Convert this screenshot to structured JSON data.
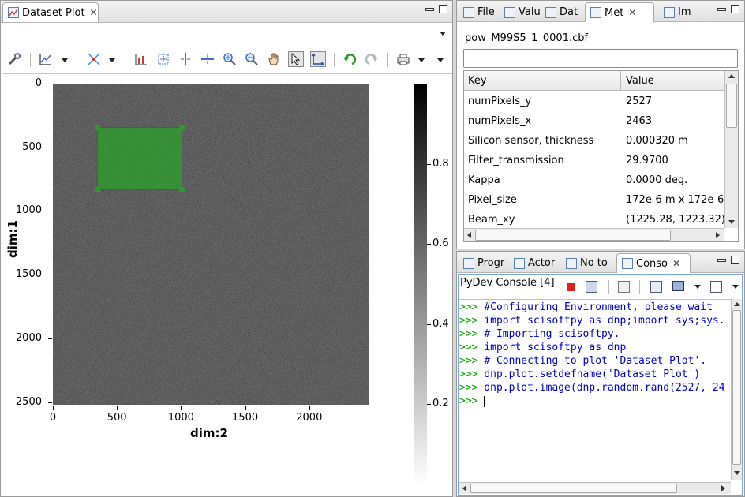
{
  "plot_view": {
    "tab_label": "Dataset Plot",
    "y_axis_label": "dim:1",
    "x_axis_label": "dim:2",
    "y_ticks": [
      "0",
      "500",
      "1000",
      "1500",
      "2000",
      "2500"
    ],
    "x_ticks": [
      "0",
      "500",
      "1000",
      "1500",
      "2000"
    ],
    "colorbar_ticks": [
      "0.8",
      "0.6",
      "0.4",
      "0.2"
    ],
    "roi_color": "#2e9a2e",
    "toolbar_icons": [
      "tools-icon",
      "chart-type-icon",
      "axes-icon",
      "histogram-icon",
      "zoom-box-icon",
      "vertical-profile-icon",
      "horizontal-profile-icon",
      "zoom-in-icon",
      "zoom-out-icon",
      "pan-hand-icon",
      "pointer-icon",
      "axes-select-icon",
      "undo-icon",
      "redo-icon",
      "print-icon"
    ]
  },
  "metadata_view": {
    "tabs": [
      "File",
      "Valu",
      "Dat",
      "Met",
      "Im"
    ],
    "active_tab": "Met",
    "filename": "pow_M99S5_1_0001.cbf",
    "filter_value": "",
    "columns": [
      "Key",
      "Value"
    ],
    "rows": [
      {
        "key": "numPixels_y",
        "value": "2527"
      },
      {
        "key": "numPixels_x",
        "value": "2463"
      },
      {
        "key": "Silicon sensor, thickness",
        "value": "0.000320 m"
      },
      {
        "key": "Filter_transmission",
        "value": "29.9700"
      },
      {
        "key": "Kappa",
        "value": "0.0000 deg."
      },
      {
        "key": "Pixel_size",
        "value": "172e-6 m x 172e-6"
      },
      {
        "key": "Beam_xy",
        "value": "(1225.28, 1223.32)"
      }
    ]
  },
  "console_view": {
    "tabs": [
      "Progr",
      "Actor",
      "No to",
      "Conso"
    ],
    "active_tab": "Conso",
    "console_title": "PyDev Console [4]",
    "prompt": ">>>",
    "lines": [
      "#Configuring Environment, please wait",
      "import scisoftpy as dnp;import sys;sys.",
      "# Importing scisoftpy.",
      "import scisoftpy as dnp",
      "# Connecting to plot 'Dataset Plot'.",
      "dnp.plot.setdefname('Dataset Plot')",
      "dnp.plot.image(dnp.random.rand(2527, 24",
      ""
    ]
  }
}
